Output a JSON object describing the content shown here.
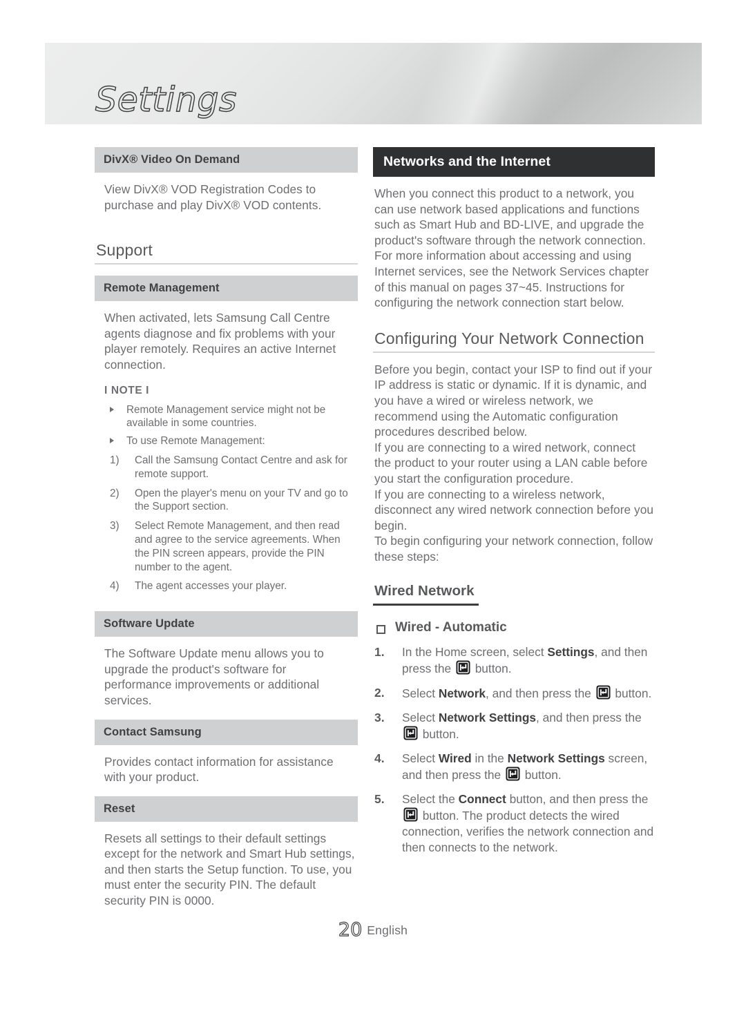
{
  "header": {
    "chapter_title": "Settings"
  },
  "left_column": {
    "divx": {
      "heading": "DivX® Video On Demand",
      "body": "View DivX® VOD Registration Codes to purchase and play DivX® VOD contents."
    },
    "support_heading": "Support",
    "remote_management": {
      "heading": "Remote Management",
      "body": "When activated, lets Samsung Call Centre agents diagnose and fix problems with your player remotely. Requires an active Internet connection.",
      "note_label": "I NOTE I",
      "notes": [
        "Remote Management service might not be available in some countries.",
        "To use Remote Management:"
      ],
      "steps": [
        {
          "num": "1)",
          "text": "Call the Samsung Contact Centre and ask for remote support."
        },
        {
          "num": "2)",
          "text": "Open the player's menu on your TV and go to the Support section."
        },
        {
          "num": "3)",
          "text": "Select Remote Management, and then read and agree to the service agreements. When the PIN screen appears, provide the PIN number to the agent."
        },
        {
          "num": "4)",
          "text": "The agent accesses your player."
        }
      ]
    },
    "software_update": {
      "heading": "Software Update",
      "body": "The Software Update menu allows you to upgrade the product's software for performance improvements or additional services."
    },
    "contact_samsung": {
      "heading": "Contact Samsung",
      "body": "Provides contact information for assistance with your product."
    },
    "reset": {
      "heading": "Reset",
      "body": "Resets all settings to their default settings except for the network and Smart Hub settings, and then starts the Setup function. To use, you must enter the security PIN. The default security PIN is 0000."
    }
  },
  "right_column": {
    "networks_heading": "Networks and the Internet",
    "networks_body": "When you connect this product to a network, you can use network based applications and functions such as Smart Hub and BD-LIVE, and upgrade the product's software through the network connection. For more information about accessing and using Internet services, see the Network Services chapter of this manual on pages 37~45. Instructions for configuring the network connection start below.",
    "configuring_heading": "Configuring Your Network Connection",
    "configuring_body_1": "Before you begin, contact your ISP to find out if your IP address is static or dynamic. If it is dynamic, and you have a wired or wireless network, we recommend using the Automatic configuration procedures described below.",
    "configuring_body_2": "If you are connecting to a wired network, connect the product to your router using a LAN cable before you start the configuration procedure.",
    "configuring_body_3": "If you are connecting to a wireless network, disconnect any wired network connection before you begin.",
    "configuring_body_4": "To begin configuring your network connection, follow these steps:",
    "wired_network_heading": "Wired Network",
    "wired_automatic_heading": "Wired - Automatic",
    "procedure": [
      {
        "num": "1.",
        "parts": [
          {
            "t": "In the Home screen, select "
          },
          {
            "t": "Settings",
            "bold": true
          },
          {
            "t": ", and then press the "
          },
          {
            "icon": "enter-button-icon"
          },
          {
            "t": " button."
          }
        ]
      },
      {
        "num": "2.",
        "parts": [
          {
            "t": "Select "
          },
          {
            "t": "Network",
            "bold": true
          },
          {
            "t": ", and then press the "
          },
          {
            "icon": "enter-button-icon"
          },
          {
            "t": " button."
          }
        ]
      },
      {
        "num": "3.",
        "parts": [
          {
            "t": "Select "
          },
          {
            "t": "Network Settings",
            "bold": true
          },
          {
            "t": ", and then press the "
          },
          {
            "icon": "enter-button-icon"
          },
          {
            "t": " button."
          }
        ]
      },
      {
        "num": "4.",
        "parts": [
          {
            "t": "Select "
          },
          {
            "t": "Wired",
            "bold": true
          },
          {
            "t": " in the "
          },
          {
            "t": "Network Settings",
            "bold": true
          },
          {
            "t": " screen, and then press the "
          },
          {
            "icon": "enter-button-icon"
          },
          {
            "t": " button."
          }
        ]
      },
      {
        "num": "5.",
        "parts": [
          {
            "t": "Select the "
          },
          {
            "t": "Connect",
            "bold": true
          },
          {
            "t": " button, and then press the "
          },
          {
            "icon": "enter-button-icon"
          },
          {
            "t": " button. The product detects the wired connection, verifies the network connection and then connects to the network."
          }
        ]
      }
    ]
  },
  "footer": {
    "page_number": "20",
    "language": "English"
  },
  "colors": {
    "subhead_bar": "#cfd0d1",
    "dark_bar": "#2f3032",
    "body_text": "#6d6e71",
    "heading_text": "#58595b",
    "rule": "#d4d5d6"
  }
}
